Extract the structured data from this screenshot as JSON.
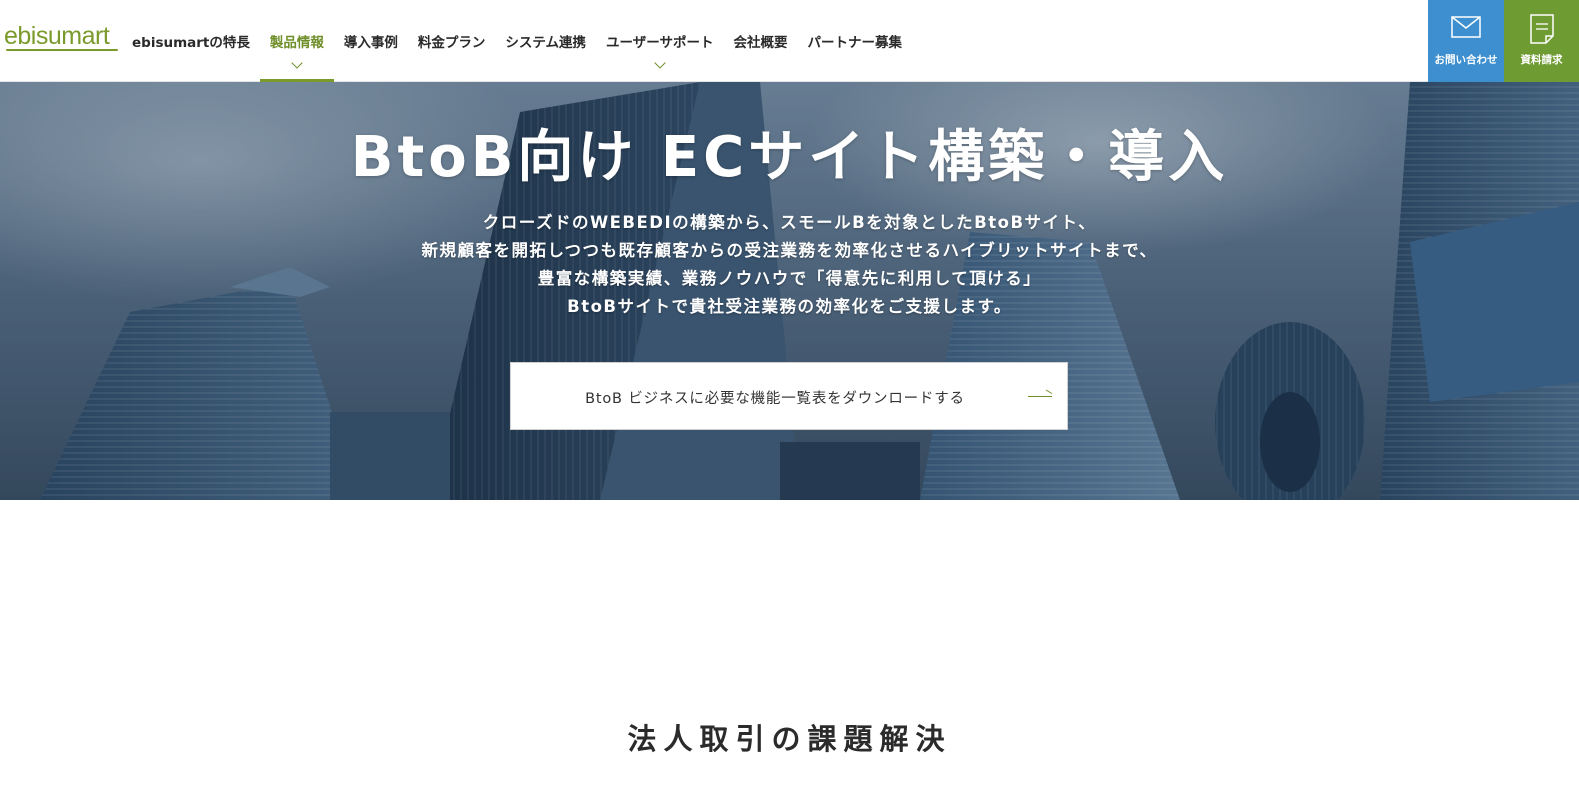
{
  "header": {
    "logo": "ebisumart",
    "nav": [
      {
        "label": "ebisumartの特長"
      },
      {
        "label": "製品情報"
      },
      {
        "label": "導入事例"
      },
      {
        "label": "料金プラン"
      },
      {
        "label": "システム連携"
      },
      {
        "label": "ユーザーサポート"
      },
      {
        "label": "会社概要"
      },
      {
        "label": "パートナー募集"
      }
    ],
    "active_nav": "製品情報",
    "contact_label": "お問い合わせ",
    "docs_label": "資料請求"
  },
  "hero": {
    "title": "BtoB向け ECサイト構築・導入",
    "description": [
      "クローズドのWEBEDIの構築から、スモールBを対象としたBtoBサイト、",
      "新規顧客を開拓しつつも既存顧客からの受注業務を効率化させるハイブリットサイトまで、",
      "豊富な構築実績、業務ノウハウで「得意先に利用して頂ける」",
      "BtoBサイトで貴社受注業務の効率化をご支援します。"
    ],
    "download_label": "BtoB ビジネスに必要な機能一覧表をダウンロードする"
  },
  "section": {
    "title": "法人取引の課題解決"
  },
  "colors": {
    "brand_green": "#7b9a2c",
    "contact_blue": "#3d8fd0",
    "docs_green": "#6f9b33"
  },
  "icons": {
    "contact": "mail-icon",
    "docs": "document-icon",
    "download": "arrow-right-icon"
  }
}
